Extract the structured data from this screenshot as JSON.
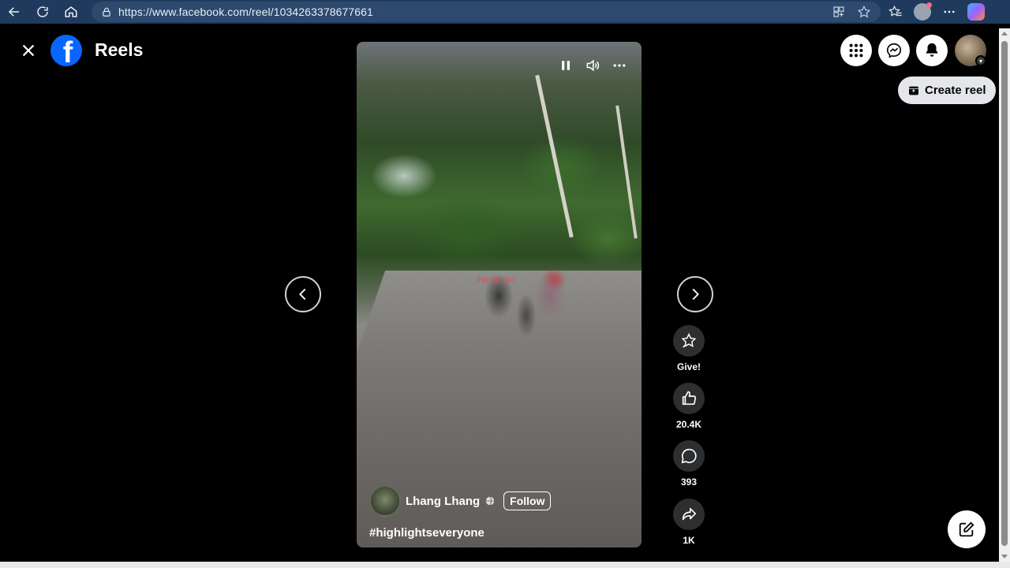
{
  "browser": {
    "url": "https://www.facebook.com/reel/1034263378677661",
    "icons": [
      "back-icon",
      "refresh-icon",
      "home-icon",
      "lock-icon",
      "apps-icon",
      "star-icon",
      "favorites-icon",
      "profile-icon",
      "more-icon",
      "copilot-icon"
    ]
  },
  "header": {
    "title": "Reels",
    "logo_letter": "f",
    "create_reel_label": "Create reel"
  },
  "video": {
    "author": "Lhang Lhang",
    "follow_label": "Follow",
    "hashtag": "#highlightseveryone",
    "watermark": "lhangmod"
  },
  "actions": {
    "give_label": "Give!",
    "like_count": "20.4K",
    "comment_count": "393",
    "share_count": "1K"
  },
  "colors": {
    "facebook_blue": "#0866ff",
    "browser_bar": "#1f3a5c",
    "action_bg": "#2d2e30"
  }
}
